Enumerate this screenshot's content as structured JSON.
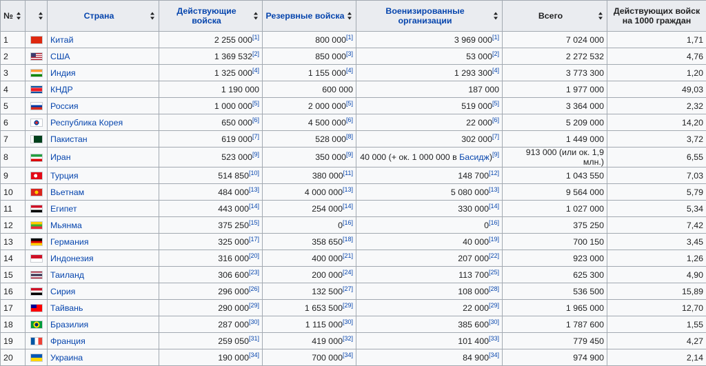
{
  "headers": {
    "num": "№",
    "flag": "",
    "country": "Страна",
    "active": "Действующие войска",
    "reserve": "Резервные войска",
    "paramilitary": "Военизированные организации",
    "total": "Всего",
    "per1000": "Действующих войск на 1000 граждан"
  },
  "rows": [
    {
      "n": "1",
      "country": "Китай",
      "flag": "china-flag",
      "active": "2 255 000",
      "active_ref": "[1]",
      "reserve": "800 000",
      "reserve_ref": "[1]",
      "para_pre": "",
      "para_link": "",
      "para": "3 969 000",
      "para_ref": "[1]",
      "total": "7 024 000",
      "per1000": "1,71"
    },
    {
      "n": "2",
      "country": "США",
      "flag": "usa-flag",
      "active": "1 369 532",
      "active_ref": "[2]",
      "reserve": "850 000",
      "reserve_ref": "[3]",
      "para_pre": "",
      "para_link": "",
      "para": "53 000",
      "para_ref": "[2]",
      "total": "2 272 532",
      "per1000": "4,76"
    },
    {
      "n": "3",
      "country": "Индия",
      "flag": "india-flag",
      "active": "1 325 000",
      "active_ref": "[4]",
      "reserve": "1 155 000",
      "reserve_ref": "[4]",
      "para_pre": "",
      "para_link": "",
      "para": "1 293 300",
      "para_ref": "[4]",
      "total": "3 773 300",
      "per1000": "1,20"
    },
    {
      "n": "4",
      "country": "КНДР",
      "flag": "dprk-flag",
      "active": "1 190 000",
      "active_ref": "",
      "reserve": "600 000",
      "reserve_ref": "",
      "para_pre": "",
      "para_link": "",
      "para": "187 000",
      "para_ref": "",
      "total": "1 977 000",
      "per1000": "49,03"
    },
    {
      "n": "5",
      "country": "Россия",
      "flag": "russia-flag",
      "active": "1 000 000",
      "active_ref": "[5]",
      "reserve": "2 000 000",
      "reserve_ref": "[5]",
      "para_pre": "",
      "para_link": "",
      "para": "519 000",
      "para_ref": "[5]",
      "total": "3 364 000",
      "per1000": "2,32"
    },
    {
      "n": "6",
      "country": "Республика Корея",
      "flag": "korea-flag",
      "active": "650 000",
      "active_ref": "[6]",
      "reserve": "4 500 000",
      "reserve_ref": "[6]",
      "para_pre": "",
      "para_link": "",
      "para": "22 000",
      "para_ref": "[6]",
      "total": "5 209 000",
      "per1000": "14,20"
    },
    {
      "n": "7",
      "country": "Пакистан",
      "flag": "pakistan-flag",
      "active": "619 000",
      "active_ref": "[7]",
      "reserve": "528 000",
      "reserve_ref": "[8]",
      "para_pre": "",
      "para_link": "",
      "para": "302 000",
      "para_ref": "[7]",
      "total": "1 449 000",
      "per1000": "3,72"
    },
    {
      "n": "8",
      "country": "Иран",
      "flag": "iran-flag",
      "active": "523 000",
      "active_ref": "[9]",
      "reserve": "350 000",
      "reserve_ref": "[9]",
      "para_pre": "40 000 (+ ок. 1 000 000 в ",
      "para_link": "Басидж",
      "para": ")",
      "para_ref": "[9]",
      "total": "913 000 (или ок. 1,9 млн.)",
      "per1000": "6,55"
    },
    {
      "n": "9",
      "country": "Турция",
      "flag": "turkey-flag",
      "active": "514 850",
      "active_ref": "[10]",
      "reserve": "380 000",
      "reserve_ref": "[11]",
      "para_pre": "",
      "para_link": "",
      "para": "148 700",
      "para_ref": "[12]",
      "total": "1 043 550",
      "per1000": "7,03"
    },
    {
      "n": "10",
      "country": "Вьетнам",
      "flag": "vietnam-flag",
      "active": "484 000",
      "active_ref": "[13]",
      "reserve": "4 000 000",
      "reserve_ref": "[13]",
      "para_pre": "",
      "para_link": "",
      "para": "5 080 000",
      "para_ref": "[13]",
      "total": "9 564 000",
      "per1000": "5,79"
    },
    {
      "n": "11",
      "country": "Египет",
      "flag": "egypt-flag",
      "active": "443 000",
      "active_ref": "[14]",
      "reserve": "254 000",
      "reserve_ref": "[14]",
      "para_pre": "",
      "para_link": "",
      "para": "330 000",
      "para_ref": "[14]",
      "total": "1 027 000",
      "per1000": "5,34"
    },
    {
      "n": "12",
      "country": "Мьянма",
      "flag": "myanmar-flag",
      "active": "375 250",
      "active_ref": "[15]",
      "reserve": "0",
      "reserve_ref": "[16]",
      "para_pre": "",
      "para_link": "",
      "para": "0",
      "para_ref": "[16]",
      "total": "375 250",
      "per1000": "7,42"
    },
    {
      "n": "13",
      "country": "Германия",
      "flag": "germany-flag",
      "active": "325 000",
      "active_ref": "[17]",
      "reserve": "358 650",
      "reserve_ref": "[18]",
      "para_pre": "",
      "para_link": "",
      "para": "40 000",
      "para_ref": "[19]",
      "total": "700 150",
      "per1000": "3,45"
    },
    {
      "n": "14",
      "country": "Индонезия",
      "flag": "indonesia-flag",
      "active": "316 000",
      "active_ref": "[20]",
      "reserve": "400 000",
      "reserve_ref": "[21]",
      "para_pre": "",
      "para_link": "",
      "para": "207 000",
      "para_ref": "[22]",
      "total": "923 000",
      "per1000": "1,26"
    },
    {
      "n": "15",
      "country": "Таиланд",
      "flag": "thailand-flag",
      "active": "306 600",
      "active_ref": "[23]",
      "reserve": "200 000",
      "reserve_ref": "[24]",
      "para_pre": "",
      "para_link": "",
      "para": "113 700",
      "para_ref": "[25]",
      "total": "625 300",
      "per1000": "4,90"
    },
    {
      "n": "16",
      "country": "Сирия",
      "flag": "syria-flag",
      "active": "296 000",
      "active_ref": "[26]",
      "reserve": "132 500",
      "reserve_ref": "[27]",
      "para_pre": "",
      "para_link": "",
      "para": "108 000",
      "para_ref": "[28]",
      "total": "536 500",
      "per1000": "15,89"
    },
    {
      "n": "17",
      "country": "Тайвань",
      "flag": "taiwan-flag",
      "active": "290 000",
      "active_ref": "[29]",
      "reserve": "1 653 500",
      "reserve_ref": "[29]",
      "para_pre": "",
      "para_link": "",
      "para": "22 000",
      "para_ref": "[29]",
      "total": "1 965 000",
      "per1000": "12,70"
    },
    {
      "n": "18",
      "country": "Бразилия",
      "flag": "brazil-flag",
      "active": "287 000",
      "active_ref": "[30]",
      "reserve": "1 115 000",
      "reserve_ref": "[30]",
      "para_pre": "",
      "para_link": "",
      "para": "385 600",
      "para_ref": "[30]",
      "total": "1 787 600",
      "per1000": "1,55"
    },
    {
      "n": "19",
      "country": "Франция",
      "flag": "france-flag",
      "active": "259 050",
      "active_ref": "[31]",
      "reserve": "419 000",
      "reserve_ref": "[32]",
      "para_pre": "",
      "para_link": "",
      "para": "101 400",
      "para_ref": "[33]",
      "total": "779 450",
      "per1000": "4,27"
    },
    {
      "n": "20",
      "country": "Украина",
      "flag": "ukraine-flag",
      "active": "190 000",
      "active_ref": "[34]",
      "reserve": "700 000",
      "reserve_ref": "[34]",
      "para_pre": "",
      "para_link": "",
      "para": "84 900",
      "para_ref": "[34]",
      "total": "974 900",
      "per1000": "2,14"
    }
  ]
}
